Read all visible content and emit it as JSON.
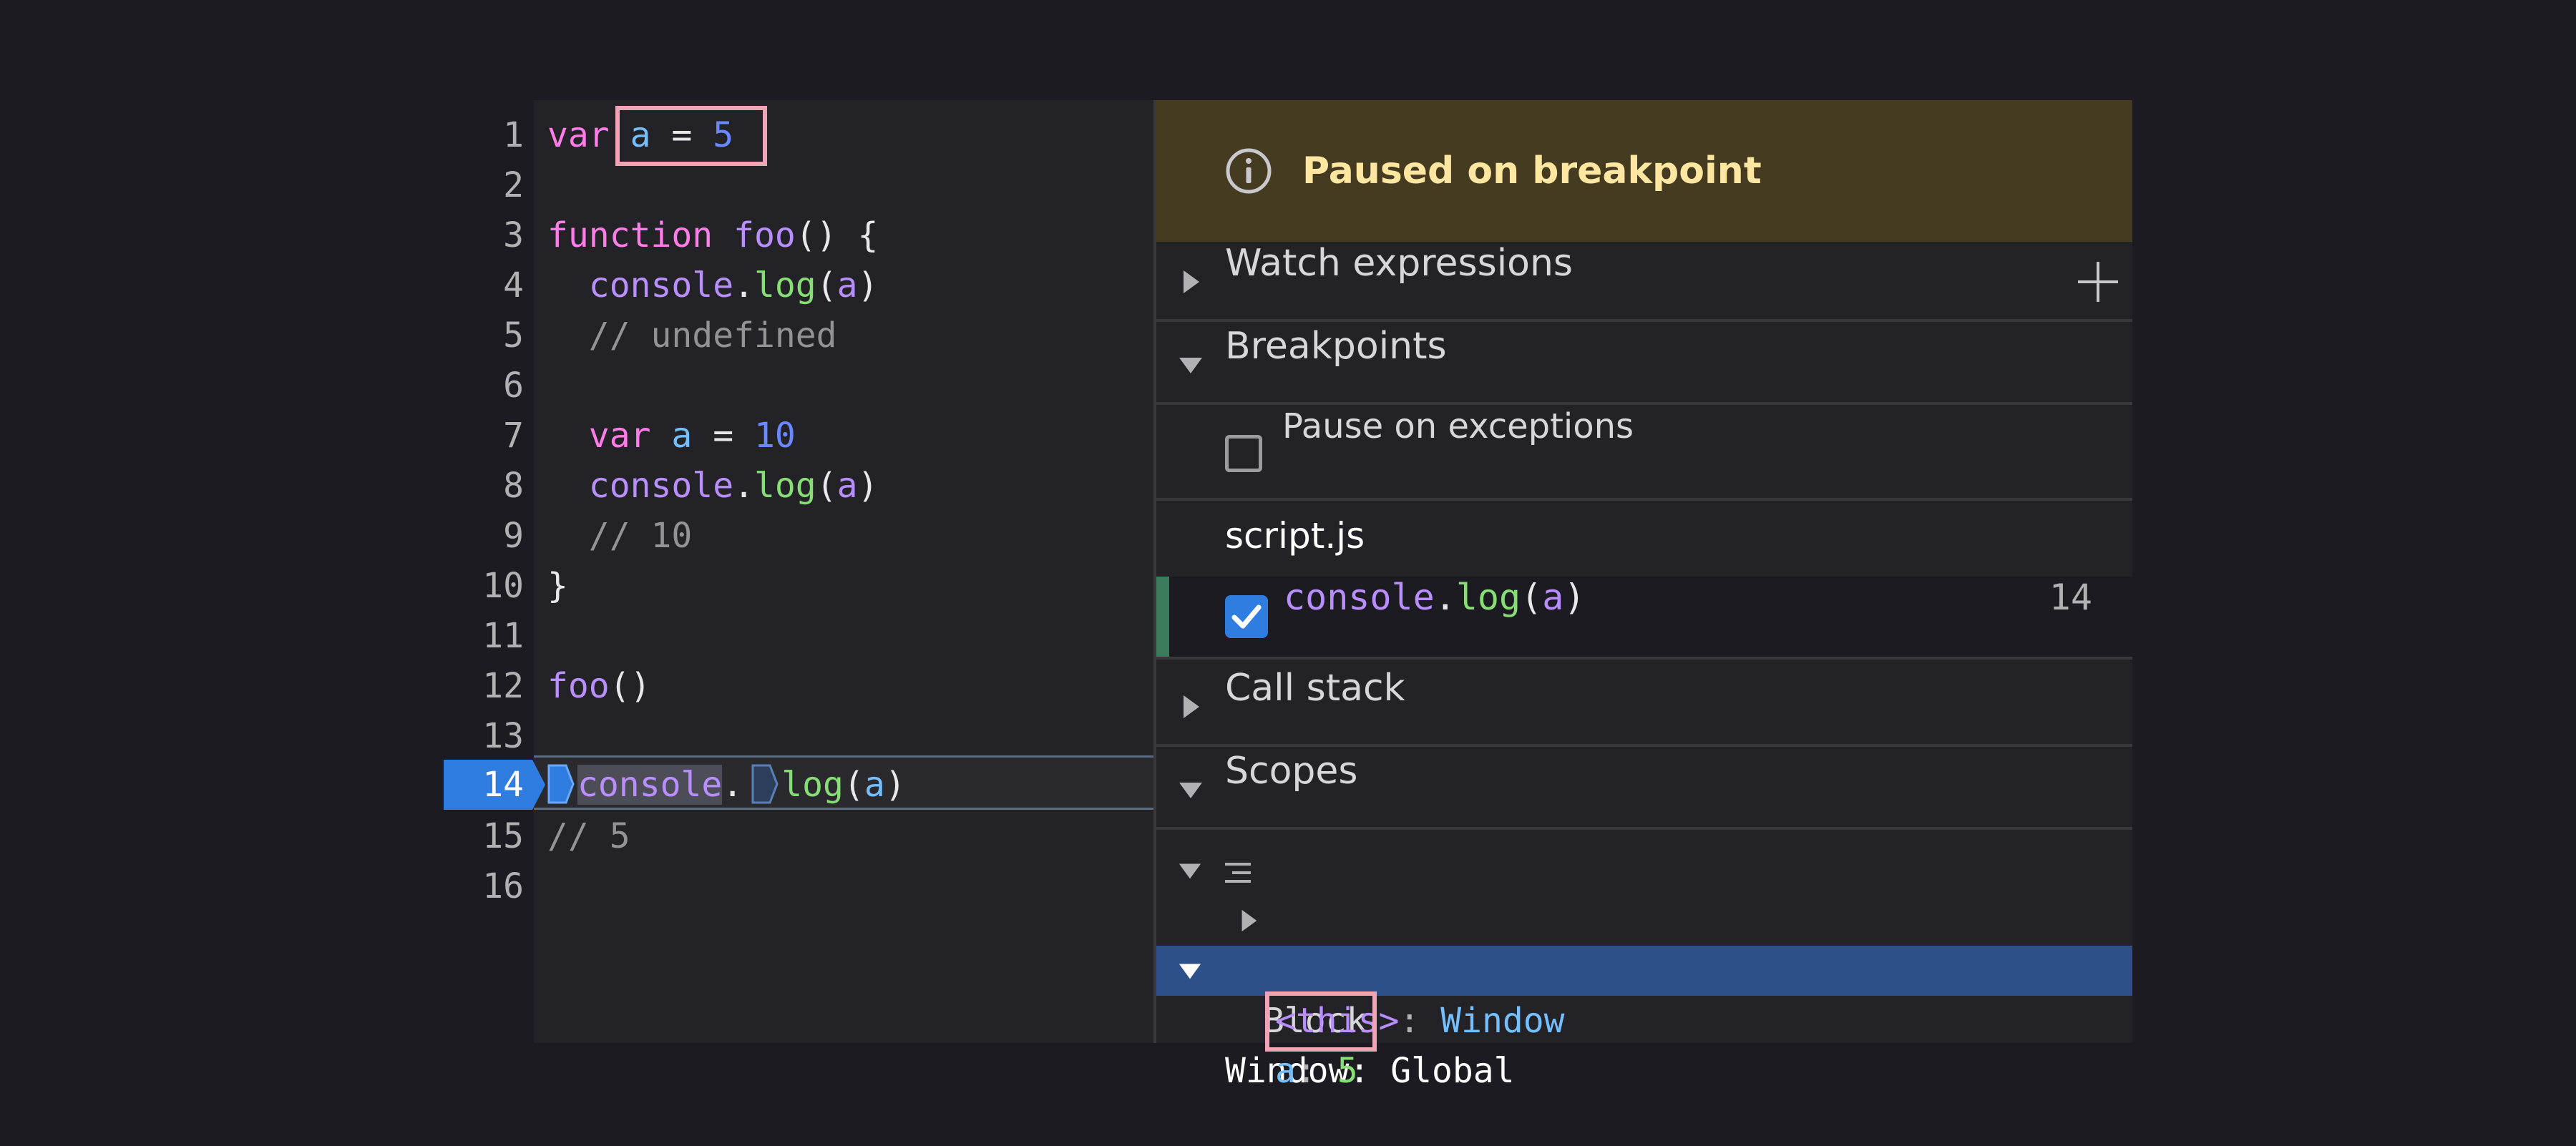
{
  "editor": {
    "line_numbers": [
      "1",
      "2",
      "3",
      "4",
      "5",
      "6",
      "7",
      "8",
      "9",
      "10",
      "11",
      "12",
      "13",
      "14",
      "15",
      "16"
    ],
    "active_line": "14",
    "lines": {
      "l1": {
        "kw": "var",
        "var": "a",
        "eq": "=",
        "num": "5"
      },
      "l3": {
        "kw": "function",
        "fn": "foo",
        "rest": "() {"
      },
      "l4": {
        "obj": "console",
        "dot": ".",
        "meth": "log",
        "open": "(",
        "arg": "a",
        "close": ")"
      },
      "l5": {
        "comment": "// undefined"
      },
      "l7": {
        "kw": "var",
        "var": "a",
        "eq": "=",
        "num": "10"
      },
      "l8": {
        "obj": "console",
        "dot": ".",
        "meth": "log",
        "open": "(",
        "arg": "a",
        "close": ")"
      },
      "l9": {
        "comment": "// 10"
      },
      "l10": {
        "text": "}"
      },
      "l12": {
        "fn": "foo",
        "rest": "()"
      },
      "l14": {
        "obj": "console",
        "dot": ".",
        "meth": "log",
        "open": "(",
        "arg": "a",
        "close": ")"
      },
      "l15": {
        "comment": "// 5"
      }
    }
  },
  "panel": {
    "paused_banner": {
      "icon": "info-icon",
      "text": "Paused on breakpoint"
    },
    "watch": {
      "label": "Watch expressions",
      "add_icon": "plus-icon"
    },
    "breakpoints": {
      "label": "Breakpoints",
      "pause_on_exceptions": {
        "label": "Pause on exceptions",
        "checked": false
      },
      "file": "script.js",
      "entry": {
        "obj": "console",
        "dot": ".",
        "meth": "log",
        "open": "(",
        "arg": "a",
        "close": ")",
        "line": "14",
        "checked": true
      }
    },
    "call_stack": {
      "label": "Call stack"
    },
    "scopes": {
      "label": "Scopes",
      "block": {
        "icon": "block-scope-icon",
        "label": "Block"
      },
      "this_entry": {
        "name": "<this>",
        "sep": ": ",
        "value": "Window"
      },
      "global": {
        "label": "Window: Global"
      },
      "var_entry": {
        "name": "a",
        "sep": ": ",
        "value": "5"
      }
    }
  },
  "colors": {
    "highlight_box": "#f0a4b6",
    "paused_banner_bg": "#453b21",
    "paused_banner_text": "#ffe7a1",
    "selected_scope_bg": "#2d4f8a",
    "breakpoint_blue": "#2f7de1"
  }
}
